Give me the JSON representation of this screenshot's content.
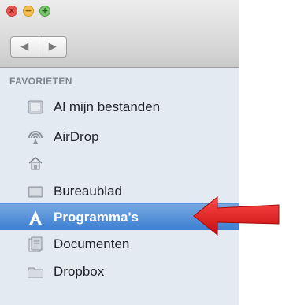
{
  "sidebar": {
    "section_title": "FAVORIETEN",
    "items": [
      {
        "label": "Al mijn bestanden",
        "icon": "all-files-icon"
      },
      {
        "label": "AirDrop",
        "icon": "airdrop-icon"
      },
      {
        "label": "",
        "icon": "home-icon"
      },
      {
        "label": "Bureaublad",
        "icon": "desktop-folder-icon"
      },
      {
        "label": "Programma's",
        "icon": "applications-icon",
        "selected": true
      },
      {
        "label": "Documenten",
        "icon": "documents-folder-icon"
      },
      {
        "label": "Dropbox",
        "icon": "dropbox-folder-icon"
      }
    ]
  },
  "toolbar": {
    "back_glyph": "◀",
    "forward_glyph": "▶"
  },
  "colors": {
    "selection": "#3d7fd1",
    "annotation_arrow": "#e01b1b"
  }
}
